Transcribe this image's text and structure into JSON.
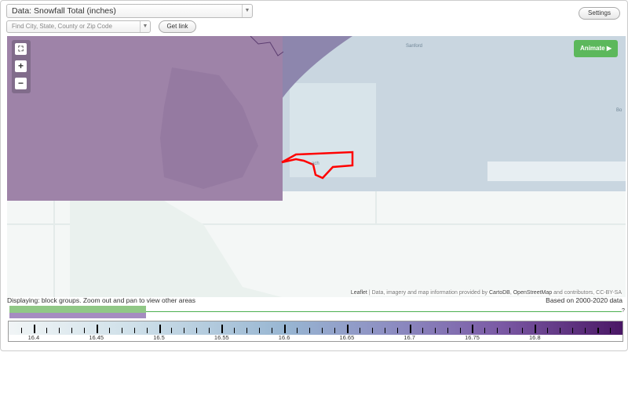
{
  "controls": {
    "data_select_label": "Data: Snowfall Total (inches)",
    "location_placeholder": "Find City, State, County or Zip Code",
    "get_link_label": "Get link",
    "settings_label": "Settings"
  },
  "map": {
    "animate_label": "Animate ▶",
    "zoom_in": "+",
    "zoom_out": "−",
    "places": {
      "sanford": "Sanford",
      "partial": "Bo",
      "inside_outline": "ach"
    },
    "attribution": {
      "leaflet": "Leaflet",
      "text1": " | Data, imagery and map information provided by ",
      "cartodb": "CartoDB",
      "sep": ", ",
      "osm": "OpenStreetMap",
      "text2": " and contributors, CC-BY-SA"
    },
    "colors": {
      "purple_region": "#9e83a8",
      "blue_region": "#c9d6e0",
      "outline": "#ff0000"
    }
  },
  "info": {
    "displaying": "Displaying: block groups. Zoom out and pan to view other areas",
    "based_on": "Based on 2000-2020 data",
    "question_mark": "?"
  },
  "legend": {
    "scale_min": 16.38,
    "scale_max": 16.87,
    "labels": [
      16.4,
      16.45,
      16.5,
      16.55,
      16.6,
      16.65,
      16.7,
      16.75,
      16.8
    ],
    "label_text": [
      "16.4",
      "16.45",
      "16.5",
      "16.55",
      "16.6",
      "16.65",
      "16.7",
      "16.75",
      "16.8"
    ],
    "bar_colors": {
      "green": "#90c886",
      "purple": "#a58cc0",
      "line": "#4caf50"
    }
  }
}
